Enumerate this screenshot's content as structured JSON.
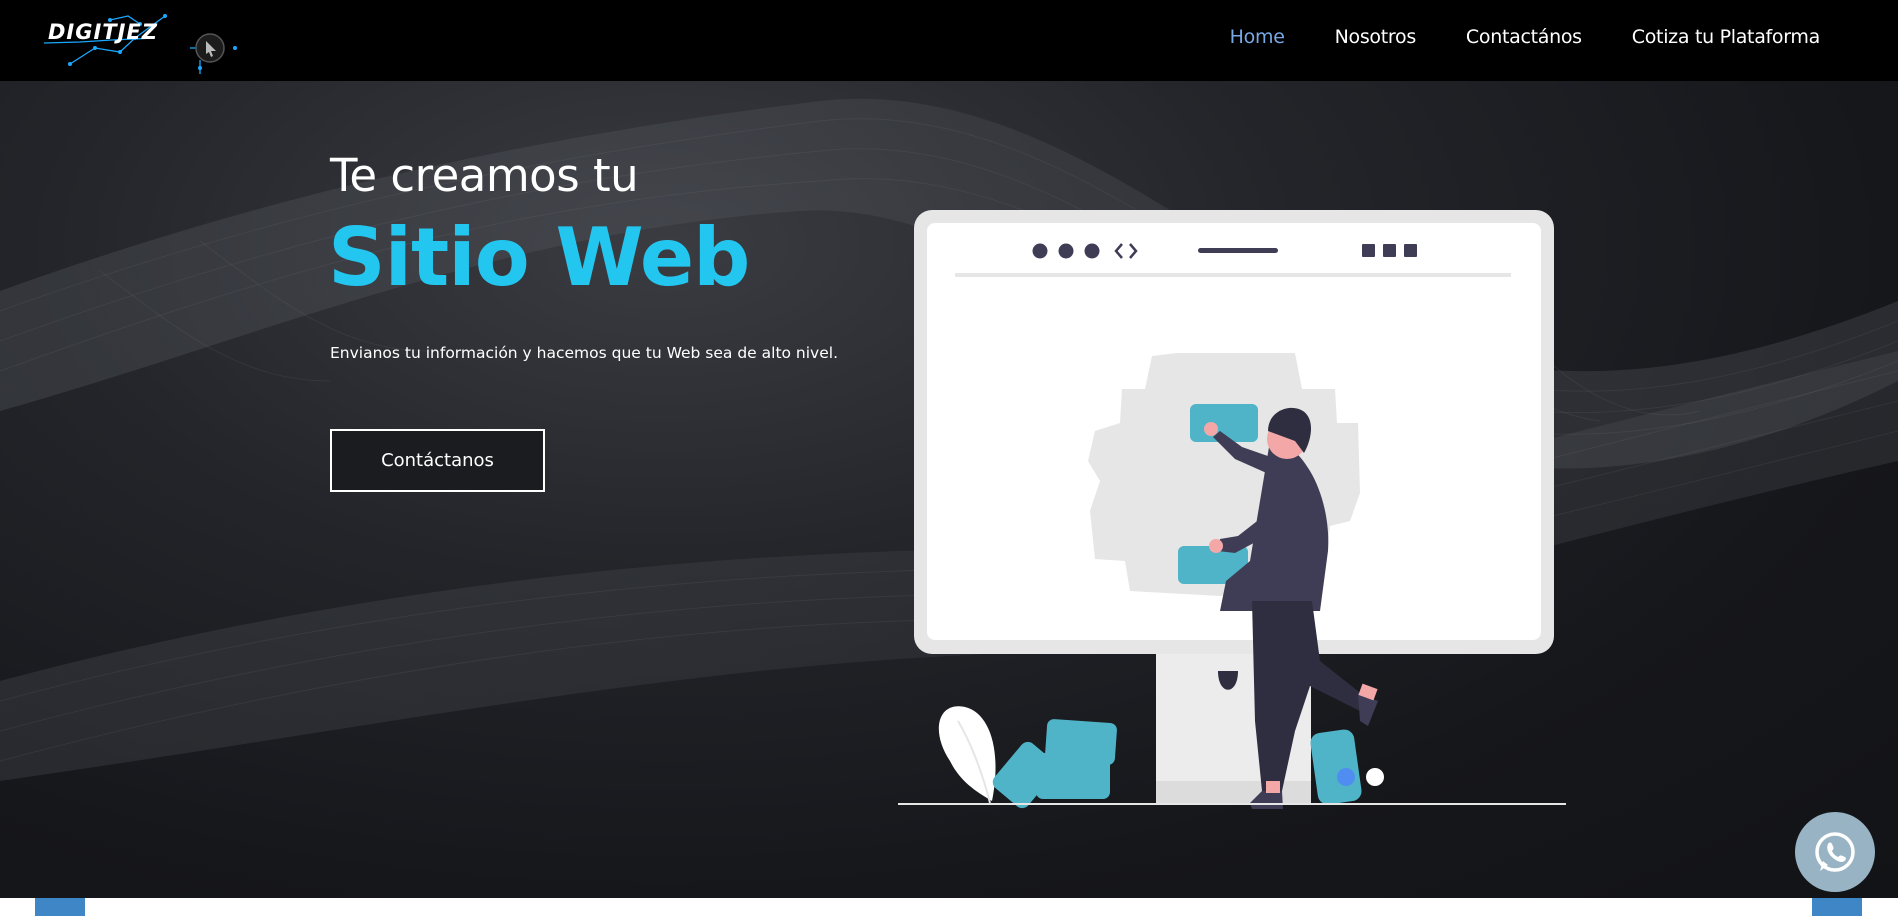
{
  "brand": {
    "logo_text": "DIGITJEZ"
  },
  "nav": {
    "items": [
      {
        "label": "Home",
        "active": true
      },
      {
        "label": "Nosotros",
        "active": false
      },
      {
        "label": "Contactános",
        "active": false
      },
      {
        "label": "Cotiza tu Plataforma",
        "active": false
      }
    ]
  },
  "hero": {
    "subtitle": "Te creamos tu",
    "title": "Sitio Web",
    "description": "Envianos tu información y hacemos que tu Web sea de alto nivel.",
    "cta_label": "Contáctanos"
  },
  "colors": {
    "navbar_bg": "#000000",
    "nav_active": "#78a8e6",
    "accent": "#23c6ef",
    "illustration_accent": "#4fb4c8",
    "hero_bg": "#1b1c20",
    "whatsapp_bg": "#97b3c4",
    "bottom_tab": "#3f86c6"
  },
  "icons": {
    "logo": "network-cursor-logo-icon",
    "floating": "whatsapp-icon"
  }
}
